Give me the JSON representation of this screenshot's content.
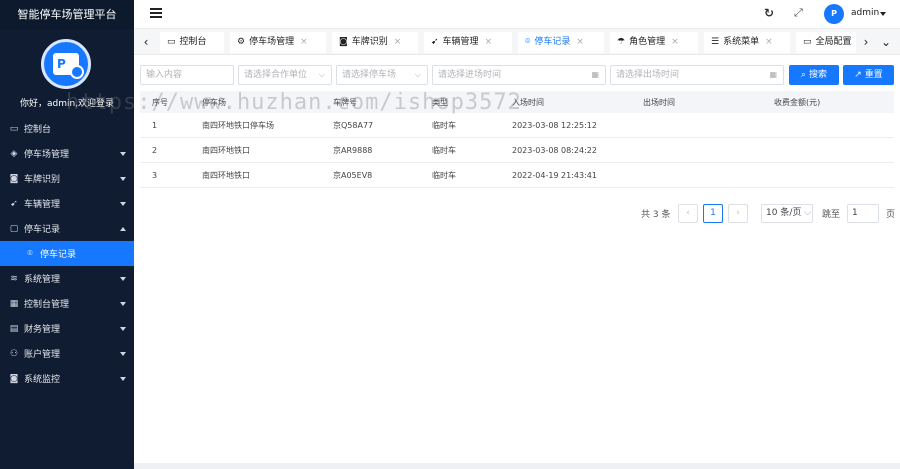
{
  "app": {
    "title": "智能停车场管理平台"
  },
  "sidebar": {
    "welcome": "你好，admin,欢迎登录",
    "items": [
      {
        "label": "控制台",
        "icon": "monitor-icon",
        "glyph": "▭",
        "has_caret": false
      },
      {
        "label": "停车场管理",
        "icon": "parking-icon",
        "glyph": "◈",
        "has_caret": true
      },
      {
        "label": "车牌识别",
        "icon": "camera-icon",
        "glyph": "◙",
        "has_caret": true
      },
      {
        "label": "车辆管理",
        "icon": "send-icon",
        "glyph": "➹",
        "has_caret": true
      },
      {
        "label": "停车记录",
        "icon": "record-icon",
        "glyph": "▢",
        "has_caret": true,
        "expanded": true
      },
      {
        "label": "停车记录",
        "icon": "location-icon",
        "glyph": "⌾",
        "sub": true,
        "active": true
      },
      {
        "label": "系统管理",
        "icon": "layers-icon",
        "glyph": "≋",
        "has_caret": true
      },
      {
        "label": "控制台管理",
        "icon": "grid-icon",
        "glyph": "▦",
        "has_caret": true
      },
      {
        "label": "财务管理",
        "icon": "finance-icon",
        "glyph": "▤",
        "has_caret": true
      },
      {
        "label": "账户管理",
        "icon": "user-icon",
        "glyph": "⚇",
        "has_caret": true
      },
      {
        "label": "系统监控",
        "icon": "monitor-camera-icon",
        "glyph": "◙",
        "has_caret": true
      }
    ]
  },
  "header": {
    "refresh_icon": "refresh-icon",
    "fullscreen_icon": "fullscreen-icon",
    "avatar_text": "P",
    "username": "admin"
  },
  "tabs": [
    {
      "label": "控制台",
      "glyph": "▭",
      "icon": "monitor-icon",
      "closable": false
    },
    {
      "label": "停车场管理",
      "glyph": "⚙",
      "icon": "gear-icon",
      "closable": true
    },
    {
      "label": "车牌识别",
      "glyph": "◙",
      "icon": "camera-icon",
      "closable": true
    },
    {
      "label": "车辆管理",
      "glyph": "➹",
      "icon": "send-icon",
      "closable": true
    },
    {
      "label": "停车记录",
      "glyph": "⌾",
      "icon": "location-icon",
      "closable": true,
      "active": true
    },
    {
      "label": "角色管理",
      "glyph": "☂",
      "icon": "umbrella-icon",
      "closable": true
    },
    {
      "label": "系统菜单",
      "glyph": "☰",
      "icon": "menu-icon",
      "closable": true
    },
    {
      "label": "全局配置",
      "glyph": "▭",
      "icon": "config-icon",
      "closable": false
    }
  ],
  "filters": {
    "keyword_placeholder": "输入内容",
    "partner_placeholder": "请选择合作单位",
    "lot_placeholder": "请选择停车场",
    "entry_time_placeholder": "请选择进场时间",
    "exit_time_placeholder": "请选择出场时间",
    "search_label": "搜索",
    "reset_label": "重置"
  },
  "table": {
    "columns": [
      "序号",
      "停车场",
      "车牌号",
      "类型",
      "入场时间",
      "出场时间",
      "收费金额(元)"
    ],
    "rows": [
      [
        "1",
        "南四环地铁口停车场",
        "京Q58A77",
        "临时车",
        "2023-03-08 12:25:12",
        "",
        ""
      ],
      [
        "2",
        "南四环地铁口",
        "京AR9888",
        "临时车",
        "2023-03-08 08:24:22",
        "",
        ""
      ],
      [
        "3",
        "南四环地铁口",
        "京A05EV8",
        "临时车",
        "2022-04-19 21:43:41",
        "",
        ""
      ]
    ]
  },
  "pagination": {
    "total_text": "共 3 条",
    "current_page": "1",
    "page_size": "10 条/页",
    "goto_label": "跳至",
    "goto_value": "1",
    "page_suffix": "页"
  },
  "watermark": "https://www.huzhan.com/ishop3572",
  "colors": {
    "accent": "#1677ff",
    "sidebar": "#0f1c31"
  }
}
